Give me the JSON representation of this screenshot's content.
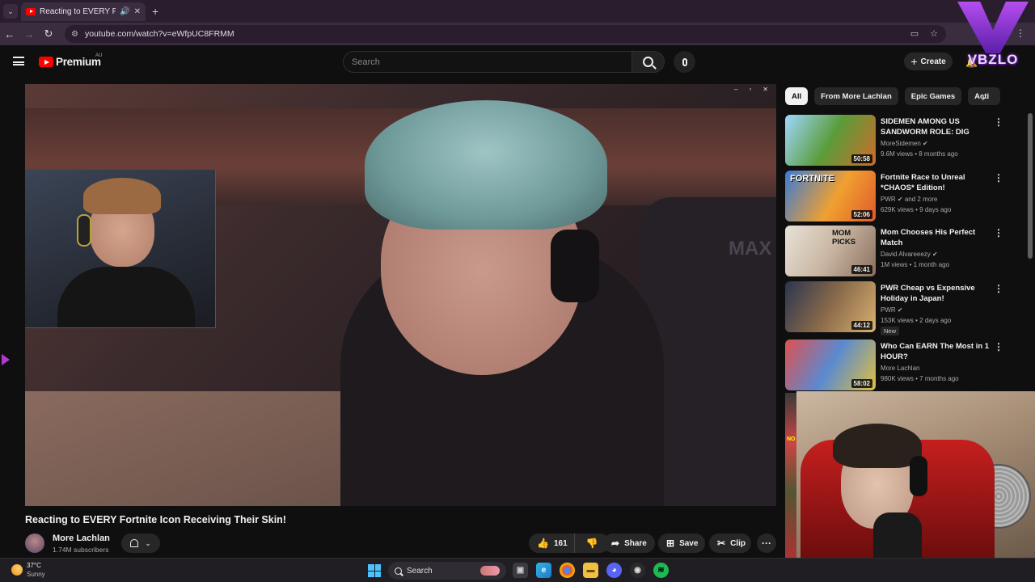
{
  "browser": {
    "tab_title": "Reacting to EVERY Fortnite",
    "tab_audio_icon": "speaker-icon",
    "new_tab": "+",
    "url": "youtube.com/watch?v=eWfpUC8FRMM"
  },
  "youtube": {
    "logo_text": "Premium",
    "region": "AU",
    "search_placeholder": "Search",
    "create_label": "Create"
  },
  "overlay_logo": "VBZLO",
  "video": {
    "title": "Reacting to EVERY Fortnite Icon Receiving Their Skin!",
    "chair_text": "MAX"
  },
  "channel": {
    "name": "More Lachlan",
    "subscribers": "1.74M subscribers"
  },
  "actions": {
    "likes": "161",
    "share": "Share",
    "save": "Save",
    "clip": "Clip"
  },
  "chips": [
    "All",
    "From More Lachlan",
    "Epic Games",
    "Acti"
  ],
  "recommendations": [
    {
      "title": "SIDEMEN AMONG US SANDWORM ROLE: DIG UNDE...",
      "channel": "MoreSidemen",
      "meta": "9.6M views • 8 months ago",
      "duration": "50:58",
      "thumb_label": "",
      "badge": ""
    },
    {
      "title": "Fortnite Race to Unreal *CHAOS* Edition!",
      "channel": "PWR",
      "channel_extra": "and 2 more",
      "meta": "629K views • 9 days ago",
      "duration": "52:06",
      "thumb_label": "FORTNITE",
      "badge": ""
    },
    {
      "title": "Mom Chooses His Perfect Match",
      "channel": "David Alvareeezy",
      "meta": "1M views • 1 month ago",
      "duration": "46:41",
      "thumb_label": "MOM PICKS",
      "badge": ""
    },
    {
      "title": "PWR Cheap vs Expensive Holiday in Japan!",
      "channel": "PWR",
      "meta": "153K views • 2 days ago",
      "duration": "44:12",
      "thumb_label": "",
      "badge": "New"
    },
    {
      "title": "Who Can EARN The Most in 1 HOUR?",
      "channel": "More Lachlan",
      "meta": "980K views • 7 months ago",
      "duration": "58:02",
      "thumb_label": "",
      "badge": ""
    }
  ],
  "strip_text": "NO",
  "taskbar": {
    "temperature": "37°C",
    "condition": "Sunny",
    "search": "Search"
  },
  "colors": {
    "youtube_red": "#ff0000",
    "browser_frame": "#3b2d40",
    "overlay_purple": "#8a2be2"
  }
}
